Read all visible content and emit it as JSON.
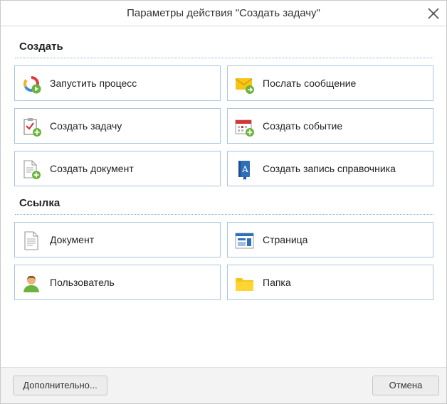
{
  "dialog": {
    "title": "Параметры действия \"Создать задачу\""
  },
  "sections": {
    "create": {
      "title": "Создать",
      "items": [
        {
          "label": "Запустить процесс",
          "icon": "process-icon"
        },
        {
          "label": "Послать сообщение",
          "icon": "message-icon"
        },
        {
          "label": "Создать задачу",
          "icon": "task-icon"
        },
        {
          "label": "Создать событие",
          "icon": "calendar-event-icon"
        },
        {
          "label": "Создать документ",
          "icon": "document-add-icon"
        },
        {
          "label": "Создать запись справочника",
          "icon": "directory-book-icon"
        }
      ]
    },
    "link": {
      "title": "Ссылка",
      "items": [
        {
          "label": "Документ",
          "icon": "document-icon"
        },
        {
          "label": "Страница",
          "icon": "page-icon"
        },
        {
          "label": "Пользователь",
          "icon": "user-icon"
        },
        {
          "label": "Папка",
          "icon": "folder-icon"
        }
      ]
    }
  },
  "footer": {
    "more_label": "Дополнительно...",
    "cancel_label": "Отмена"
  },
  "colors": {
    "tile_border": "#a9c6de",
    "section_line": "#8ab0d6",
    "green_badge": "#6ab43e"
  }
}
